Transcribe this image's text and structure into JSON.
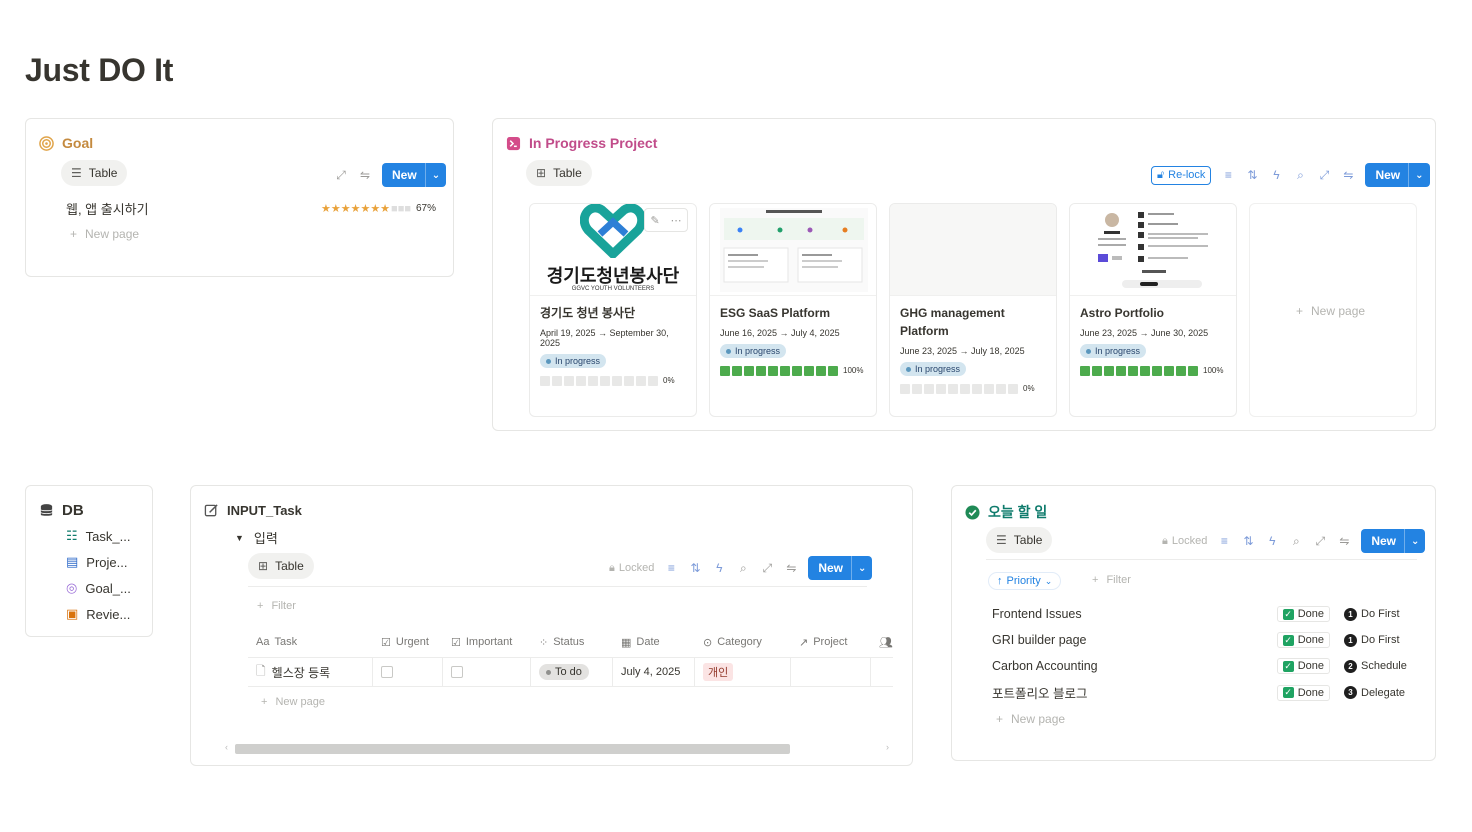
{
  "page": {
    "title": "Just DO It"
  },
  "goal": {
    "title": "Goal",
    "view_tab": "Table",
    "new_label": "New",
    "item": {
      "name": "웹, 앱 출시하기",
      "stars_filled": 7,
      "stars_total": 10,
      "percent": "67%"
    },
    "new_page": "New page"
  },
  "projects": {
    "title": "In Progress Project",
    "view_tab": "Table",
    "relock": "Re-lock",
    "new_label": "New",
    "new_page": "New page",
    "cards": [
      {
        "cover_headline": "경기도청년봉사단",
        "cover_sub": "GGVC YOUTH VOLUNTEERS",
        "title": "경기도 청년 봉사단",
        "date": "April 19, 2025 → September 30, 2025",
        "status": "In progress",
        "progress": 0,
        "percent": "0%"
      },
      {
        "title": "ESG SaaS Platform",
        "date": "June 16, 2025 → July 4, 2025",
        "status": "In progress",
        "progress": 10,
        "percent": "100%"
      },
      {
        "title": "GHG management Platform",
        "date": "June 23, 2025 → July 18, 2025",
        "status": "In progress",
        "progress": 0,
        "percent": "0%"
      },
      {
        "title": "Astro Portfolio",
        "date": "June 23, 2025 → June 30, 2025",
        "status": "In progress",
        "progress": 10,
        "percent": "100%"
      }
    ]
  },
  "db": {
    "title": "DB",
    "items": [
      {
        "label": "Task_..."
      },
      {
        "label": "Proje..."
      },
      {
        "label": "Goal_..."
      },
      {
        "label": "Revie..."
      }
    ]
  },
  "input_task": {
    "title": "INPUT_Task",
    "toggle": "입력",
    "view_tab": "Table",
    "locked": "Locked",
    "new_label": "New",
    "filter": "Filter",
    "columns": [
      "Task",
      "Urgent",
      "Important",
      "Status",
      "Date",
      "Category",
      "Project"
    ],
    "row": {
      "task": "헬스장 등록",
      "status": "To do",
      "date": "July 4, 2025",
      "category": "개인"
    },
    "new_page": "New page"
  },
  "today": {
    "title": "오늘 할 일",
    "view_tab": "Table",
    "locked": "Locked",
    "new_label": "New",
    "sort": "Priority",
    "filter": "Filter",
    "rows": [
      {
        "name": "Frontend Issues",
        "status": "Done",
        "priority_num": "1",
        "priority": "Do First"
      },
      {
        "name": "GRI builder page",
        "status": "Done",
        "priority_num": "1",
        "priority": "Do First"
      },
      {
        "name": "Carbon Accounting",
        "status": "Done",
        "priority_num": "2",
        "priority": "Schedule"
      },
      {
        "name": "포트폴리오 블로그",
        "status": "Done",
        "priority_num": "3",
        "priority": "Delegate"
      }
    ],
    "new_page": "New page"
  },
  "colors": {
    "accent": "#2383e2",
    "done": "#1fa362",
    "progress": "#4dab4d",
    "goal": "#d9730d",
    "project": "#c14c8a",
    "today": "#0f7b6c"
  }
}
